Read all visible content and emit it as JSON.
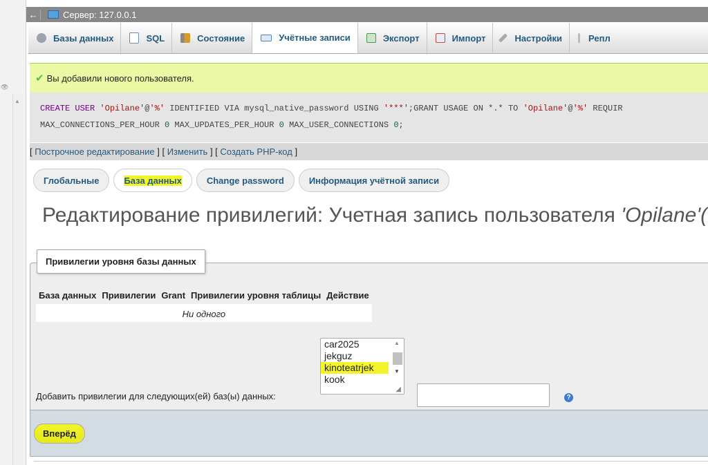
{
  "topbar": {
    "back": "←",
    "server": "Сервер: 127.0.0.1"
  },
  "tabs": [
    {
      "label": "Базы данных",
      "icon": "database-icon",
      "color": "#9aa4ad"
    },
    {
      "label": "SQL",
      "icon": "sql-icon",
      "color": "#6b8fb3"
    },
    {
      "label": "Состояние",
      "icon": "status-icon",
      "color": "#d49a2a"
    },
    {
      "label": "Учётные записи",
      "icon": "users-icon",
      "color": "#4a86c8"
    },
    {
      "label": "Экспорт",
      "icon": "export-icon",
      "color": "#4b9a4b"
    },
    {
      "label": "Импорт",
      "icon": "import-icon",
      "color": "#c44"
    },
    {
      "label": "Настройки",
      "icon": "wrench-icon",
      "color": "#888"
    },
    {
      "label": "Репл",
      "icon": "replication-icon",
      "color": "#bbb"
    }
  ],
  "notice": {
    "text": "Вы добавили нового пользователя."
  },
  "sql": {
    "line1_a": "CREATE USER ",
    "line1_user": "'Opilane'",
    "line1_b": "@",
    "line1_host": "'%'",
    "line1_c": " IDENTIFIED VIA mysql_native_password USING ",
    "line1_pass": "'***'",
    "line1_d": ";GRANT USAGE ON *.* TO ",
    "line1_user2": "'Opilane'",
    "line1_e": "@",
    "line1_host2": "'%'",
    "line1_f": " REQUIR",
    "line2_a": "MAX_CONNECTIONS_PER_HOUR ",
    "line2_n1": "0",
    "line2_b": " MAX_UPDATES_PER_HOUR ",
    "line2_n2": "0",
    "line2_c": " MAX_USER_CONNECTIONS ",
    "line2_n3": "0",
    "line2_d": ";"
  },
  "sqllinks": {
    "inline": "Построчное редактирование",
    "edit": "Изменить",
    "php": "Создать PHP-код"
  },
  "subtabs": {
    "global": "Глобальные",
    "database": "База данных",
    "password": "Change password",
    "account": "Информация учётной записи"
  },
  "page_title": {
    "prefix": "Редактирование привилегий: Учетная запись пользователя ",
    "user": "'Opilane'("
  },
  "section": {
    "legend": "Привилегии уровня базы данных",
    "columns": [
      "База данных",
      "Привилегии",
      "Grant",
      "Привилегии уровня таблицы",
      "Действие"
    ],
    "empty": "Ни одного"
  },
  "add": {
    "label": "Добавить привилегии для следующих(ей) баз(ы) данных:",
    "options": [
      "car2025",
      "jekguz",
      "kinoteatrjek",
      "kook"
    ],
    "selected": "kinoteatrjek",
    "input_value": ""
  },
  "go_button": "Вперёд",
  "colors": {
    "notice_bg": "#ebf8a4",
    "highlight": "#f3f52a",
    "link": "#235a81"
  }
}
